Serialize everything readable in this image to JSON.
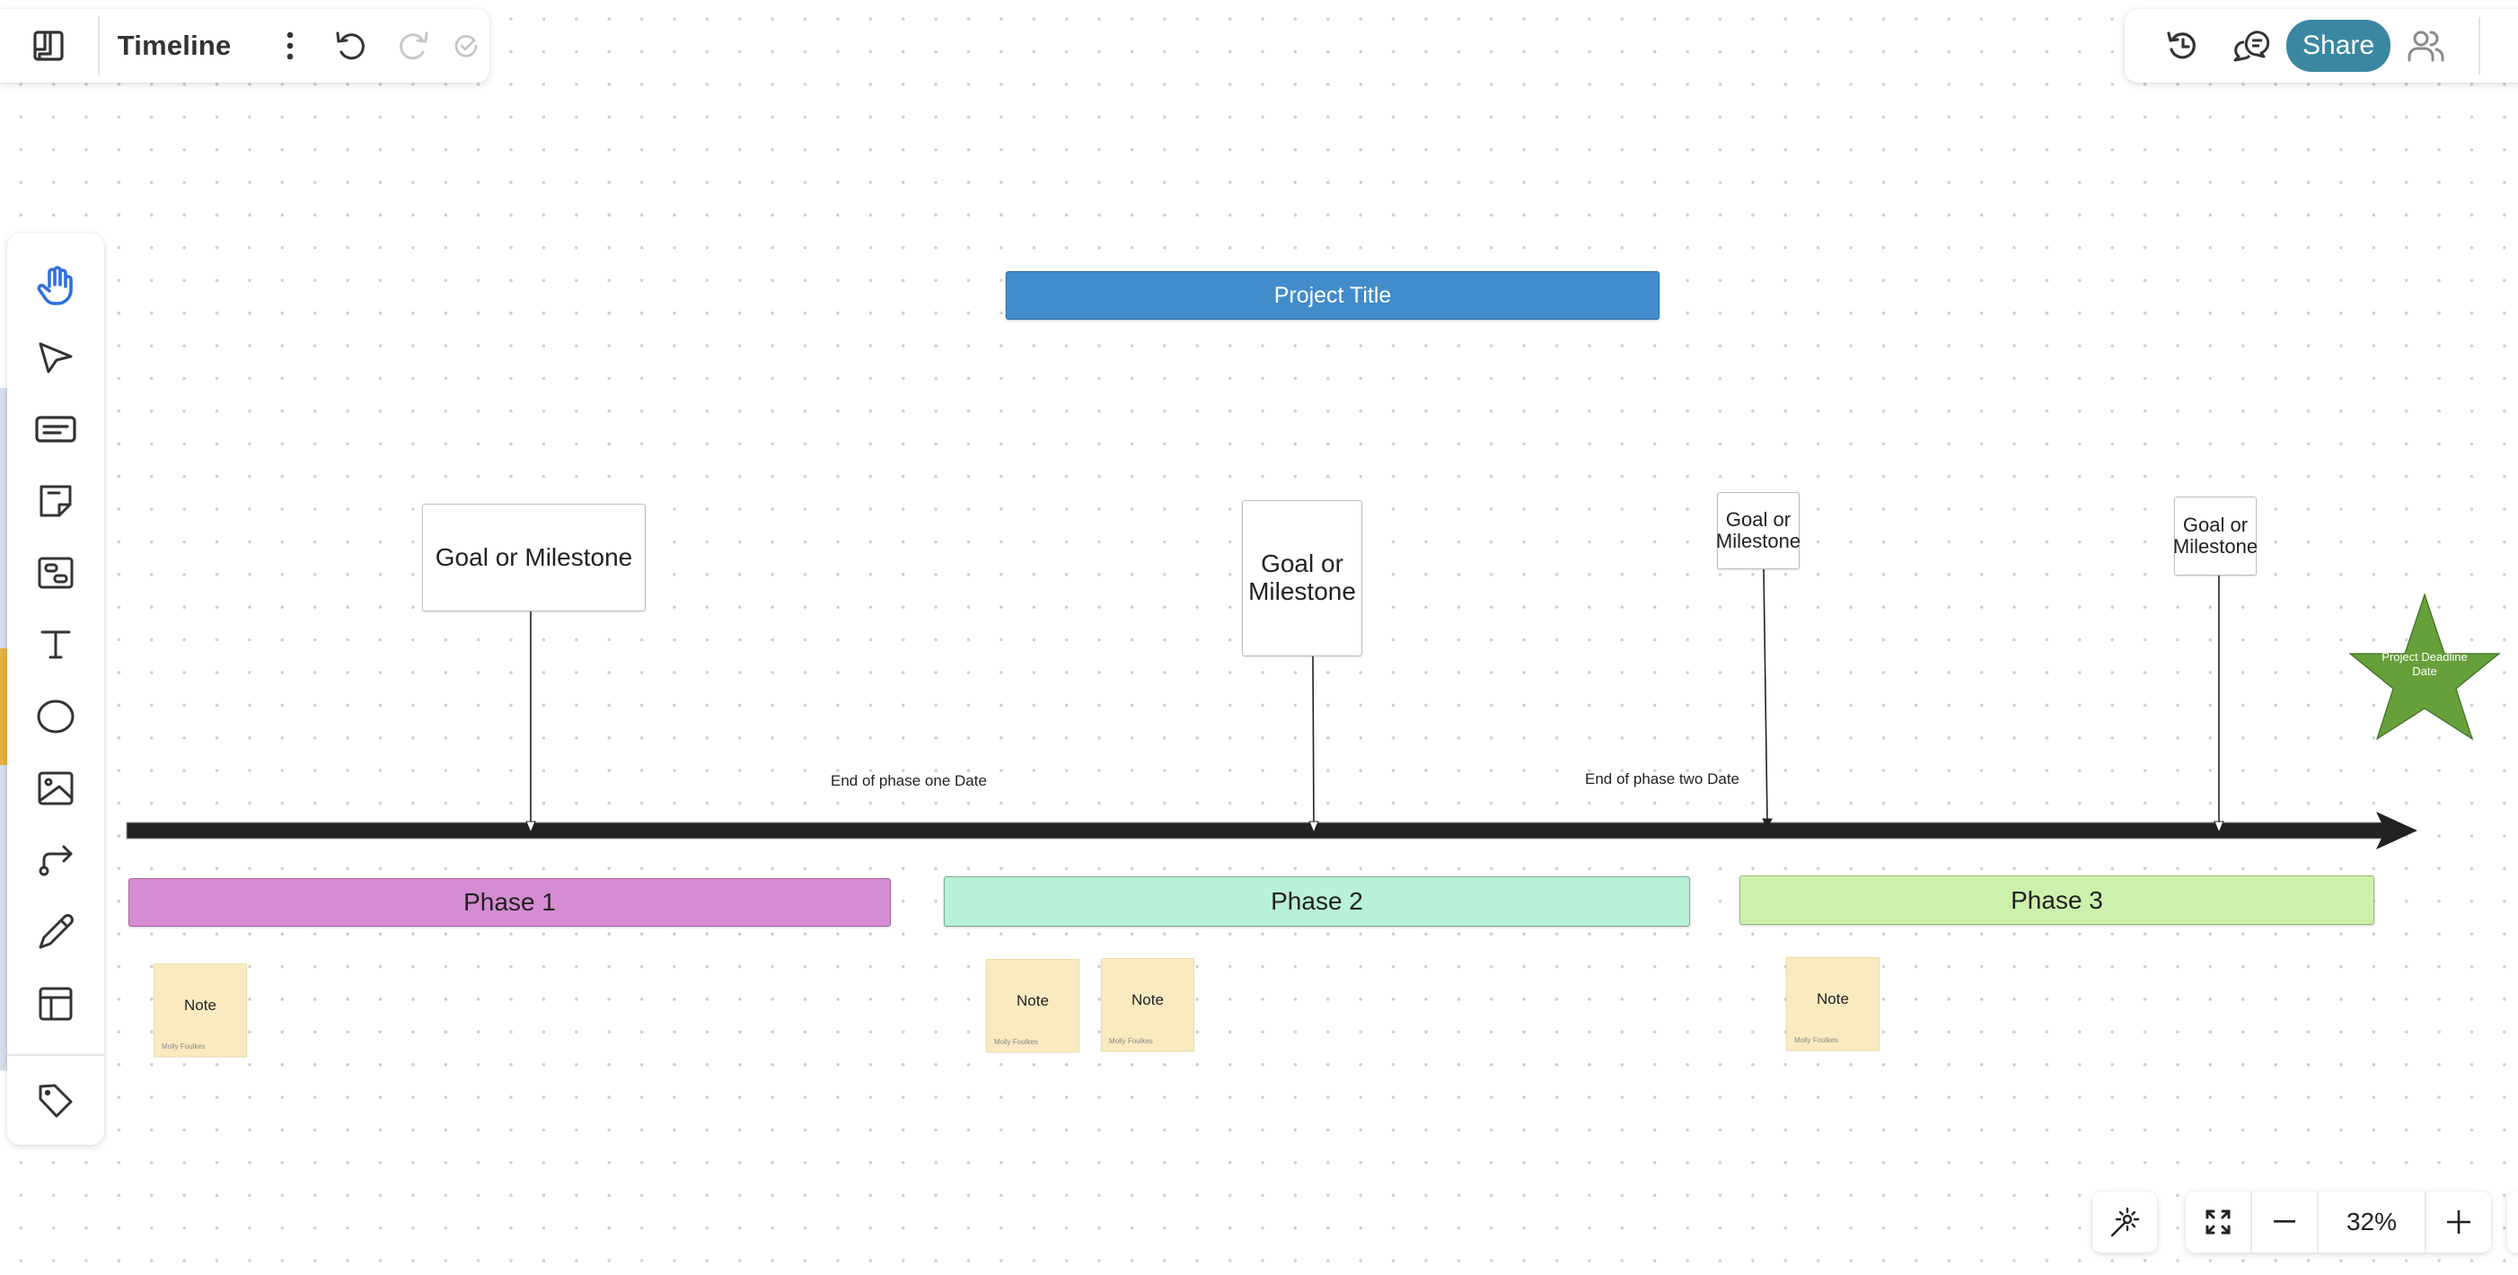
{
  "header": {
    "board_title": "Timeline",
    "icons": {
      "logo": "board-logo-icon",
      "more": "more-vertical-icon",
      "undo": "undo-icon",
      "redo": "redo-icon",
      "saved": "saved-check-icon"
    }
  },
  "top_right": {
    "share_label": "Share",
    "icons": [
      "history-icon",
      "comments-icon",
      "collaborators-icon"
    ]
  },
  "toolbar": {
    "tools": [
      {
        "name": "hand-tool",
        "icon": "hand-icon",
        "active": true
      },
      {
        "name": "select-tool",
        "icon": "pointer-icon",
        "active": false
      },
      {
        "name": "text-box-tool",
        "icon": "text-box-icon",
        "active": false
      },
      {
        "name": "sticky-note-tool",
        "icon": "sticky-note-icon",
        "active": false
      },
      {
        "name": "card-tool",
        "icon": "card-icon",
        "active": false
      },
      {
        "name": "text-tool",
        "icon": "text-icon",
        "active": false
      },
      {
        "name": "shape-tool",
        "icon": "circle-icon",
        "active": false
      },
      {
        "name": "image-tool",
        "icon": "image-icon",
        "active": false
      },
      {
        "name": "connector-tool",
        "icon": "connector-icon",
        "active": false
      },
      {
        "name": "pen-tool",
        "icon": "pencil-icon",
        "active": false
      },
      {
        "name": "template-tool",
        "icon": "layout-icon",
        "active": false
      },
      {
        "name": "tag-tool",
        "icon": "tag-icon",
        "active": false
      }
    ],
    "active_color": "#2f6fe0"
  },
  "canvas": {
    "project_title": "Project Title",
    "milestones": [
      {
        "label": "Goal or Milestone"
      },
      {
        "label": "Goal or Milestone"
      },
      {
        "label": "Goal or Milestone"
      },
      {
        "label": "Goal or Milestone"
      }
    ],
    "phase_end_labels": [
      "End of phase one Date",
      "End of phase two Date"
    ],
    "phases": [
      {
        "label": "Phase 1",
        "color": "#d58cd3"
      },
      {
        "label": "Phase 2",
        "color": "#b8f0d8"
      },
      {
        "label": "Phase 3",
        "color": "#cdf1ad"
      }
    ],
    "notes": [
      {
        "text": "Note",
        "author": "Molly Foulkes"
      },
      {
        "text": "Note",
        "author": "Molly Foulkes"
      },
      {
        "text": "Note",
        "author": "Molly Foulkes"
      },
      {
        "text": "Note",
        "author": "Molly Foulkes"
      }
    ],
    "deadline": {
      "label": "Project Deadline Date",
      "color": "#65a03a"
    },
    "title_color": "#428ccb"
  },
  "bottom_controls": {
    "zoom_level": "32%",
    "zoom_out_label": "−",
    "zoom_in_label": "+",
    "icons": [
      "magic-wand-icon",
      "fit-screen-icon"
    ]
  }
}
